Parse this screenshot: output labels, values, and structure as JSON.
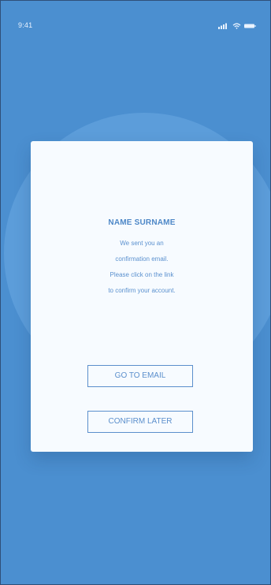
{
  "status_bar": {
    "time": "9:41",
    "icons": [
      "signal-icon",
      "wifi-icon",
      "battery-icon"
    ]
  },
  "card": {
    "name": "NAME SURNAME",
    "message_lines": [
      "We sent you an",
      "confirmation email.",
      "Please click on the link",
      "to confirm your account."
    ]
  },
  "buttons": {
    "go_to_email": "GO TO EMAIL",
    "confirm_later": "CONFIRM LATER"
  },
  "colors": {
    "background": "#4b8fd0",
    "background_circle": "#63a2de",
    "card": "#f7fbff",
    "accent": "#5b8fcc"
  }
}
